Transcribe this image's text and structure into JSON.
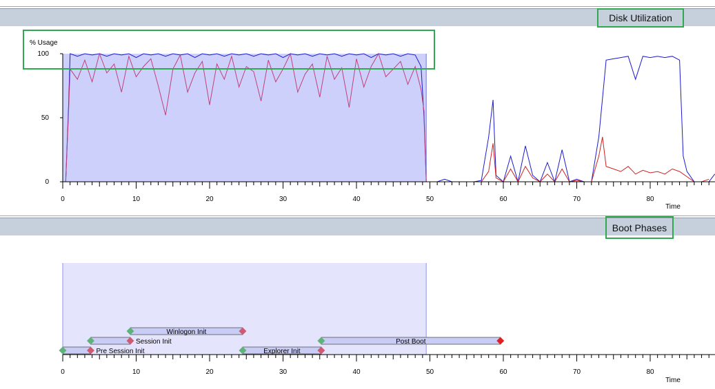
{
  "panels": {
    "disk": {
      "title": "Disk Utilization"
    },
    "boot": {
      "title": "Boot Phases"
    }
  },
  "chart_data": [
    {
      "type": "line",
      "title": "Disk Utilization",
      "ylabel": "% Usage",
      "xlabel": "Time",
      "xlim": [
        0,
        89
      ],
      "ylim": [
        0,
        100
      ],
      "x_ticks": [
        0,
        10,
        20,
        30,
        40,
        50,
        60,
        70,
        80
      ],
      "y_ticks": [
        0,
        50,
        100
      ],
      "highlight_range": [
        0,
        49.5
      ],
      "colors": {
        "blue": "#1a1ad0",
        "red": "#d02020",
        "pink": "#c0407a",
        "highlight": "#cdd0fb"
      },
      "series": [
        {
          "color": "blue",
          "x": [
            0,
            0.4,
            0.8,
            1,
            2,
            3,
            4,
            5,
            6,
            7,
            8,
            9,
            10,
            11,
            12,
            13,
            14,
            15,
            16,
            17,
            18,
            19,
            20,
            21,
            22,
            23,
            24,
            25,
            26,
            27,
            28,
            29,
            30,
            31,
            32,
            33,
            34,
            35,
            36,
            37,
            38,
            39,
            40,
            41,
            42,
            43,
            44,
            45,
            46,
            47,
            48,
            48.8,
            49.2,
            49.5,
            50,
            51,
            52,
            53,
            54,
            55,
            56,
            57,
            58,
            58.6,
            59,
            60,
            61,
            62,
            63,
            64,
            65,
            66,
            67,
            68,
            69,
            70,
            71,
            72,
            73,
            73.5,
            74,
            75,
            76,
            77,
            78,
            79,
            80,
            81,
            82,
            83,
            84,
            84.5,
            85,
            86,
            87,
            88,
            88.8
          ],
          "y": [
            0,
            0,
            60,
            100,
            98,
            100,
            99,
            100,
            98,
            100,
            99,
            100,
            97,
            100,
            99,
            100,
            98,
            100,
            99,
            100,
            97,
            100,
            99,
            100,
            98,
            100,
            99,
            100,
            98,
            100,
            99,
            100,
            97,
            100,
            99,
            100,
            98,
            100,
            99,
            100,
            98,
            100,
            99,
            100,
            97,
            100,
            99,
            100,
            98,
            100,
            99,
            90,
            50,
            0,
            0,
            0,
            2,
            0,
            0,
            0,
            0,
            1,
            35,
            64,
            5,
            0,
            20,
            0,
            28,
            5,
            0,
            15,
            0,
            25,
            0,
            2,
            0,
            0,
            35,
            65,
            95,
            96,
            97,
            98,
            80,
            98,
            97,
            98,
            97,
            98,
            95,
            20,
            8,
            0,
            0,
            0,
            6
          ]
        },
        {
          "color": "pink",
          "x": [
            0,
            0.4,
            0.8,
            1,
            2,
            3,
            4,
            5,
            6,
            7,
            8,
            9,
            10,
            11,
            12,
            13,
            14,
            15,
            16,
            17,
            18,
            19,
            20,
            21,
            22,
            23,
            24,
            25,
            26,
            27,
            28,
            29,
            30,
            31,
            32,
            33,
            34,
            35,
            36,
            37,
            38,
            39,
            40,
            41,
            42,
            43,
            44,
            45,
            46,
            47,
            48,
            48.8,
            49.2,
            49.5
          ],
          "y": [
            0,
            0,
            55,
            88,
            80,
            95,
            78,
            100,
            85,
            92,
            70,
            98,
            82,
            90,
            96,
            75,
            52,
            88,
            99,
            70,
            85,
            94,
            60,
            92,
            80,
            98,
            74,
            90,
            86,
            63,
            95,
            78,
            88,
            100,
            70,
            84,
            92,
            66,
            98,
            80,
            89,
            58,
            96,
            74,
            90,
            100,
            82,
            88,
            94,
            76,
            90,
            72,
            55,
            0
          ]
        },
        {
          "color": "red",
          "x": [
            49.5,
            50,
            51,
            52,
            53,
            54,
            55,
            56,
            57,
            58,
            58.6,
            59,
            60,
            61,
            62,
            63,
            64,
            65,
            66,
            67,
            68,
            69,
            70,
            71,
            72,
            73,
            73.5,
            74,
            75,
            76,
            77,
            78,
            79,
            80,
            81,
            82,
            83,
            84,
            85,
            86,
            87,
            88
          ],
          "y": [
            0,
            0,
            0,
            0,
            0,
            0,
            0,
            0,
            0,
            8,
            30,
            3,
            0,
            10,
            0,
            12,
            3,
            0,
            6,
            0,
            10,
            0,
            1,
            0,
            0,
            20,
            35,
            12,
            10,
            8,
            12,
            6,
            9,
            7,
            8,
            6,
            10,
            8,
            4,
            0,
            0,
            2
          ]
        }
      ]
    },
    {
      "type": "gantt",
      "title": "Boot Phases",
      "xlabel": "Time",
      "xlim": [
        0,
        89
      ],
      "x_ticks": [
        0,
        10,
        20,
        30,
        40,
        50,
        60,
        70,
        80
      ],
      "highlight_range": [
        0,
        49.5
      ],
      "colors": {
        "start": "#5fb27a",
        "end": "#d05a72",
        "end_last": "#e02020",
        "bar": "#c9ccf5",
        "highlight": "#e4e5fc"
      },
      "phases": [
        {
          "name": "Pre Session Init",
          "start": 0,
          "end": 3.8,
          "row": 0,
          "label_pos": "right"
        },
        {
          "name": "Session Init",
          "start": 3.8,
          "end": 9.2,
          "row": 1,
          "label_pos": "right"
        },
        {
          "name": "Winlogon Init",
          "start": 9.2,
          "end": 24.5,
          "row": 2,
          "label_pos": "center"
        },
        {
          "name": "Explorer Init",
          "start": 24.5,
          "end": 35.2,
          "row": 0,
          "label_pos": "center"
        },
        {
          "name": "Post Boot",
          "start": 35.2,
          "end": 59.6,
          "row": 1,
          "label_pos": "center"
        }
      ]
    }
  ]
}
